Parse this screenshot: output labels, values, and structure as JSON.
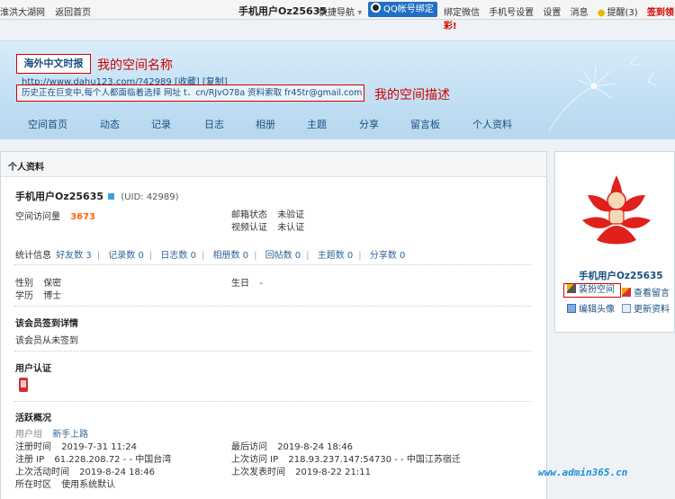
{
  "topbar": {
    "site": "淮洪大湖网",
    "back_home": "返回首页",
    "user": "手机用户Oz25635",
    "quick_nav": "快捷导航",
    "qq_bind": "QQ帐号绑定",
    "links": [
      "绑定微信",
      "手机号设置",
      "设置",
      "消息"
    ],
    "remind": "提醒(3)",
    "signin": "签到领彩!"
  },
  "banner": {
    "space_name": "海外中文时报",
    "space_name_note": "我的空间名称",
    "url_line": "http://www.dahu123.com/?42989 [收藏] [复制]",
    "description": "历史正在巨变中,每个人都面临着选择 网址 t．cn/RJvO78a 资料索取 fr45tr@gmail.com",
    "description_note": "我的空间描述",
    "tabs": [
      "空间首页",
      "动态",
      "记录",
      "日志",
      "相册",
      "主题",
      "分享",
      "留言板",
      "个人资料"
    ]
  },
  "profile": {
    "panel_title": "个人资料",
    "username": "手机用户Oz25635",
    "uid": "(UID: 42989)",
    "visits_label": "空间访问量",
    "visits_value": "3673",
    "email_label": "邮箱状态",
    "email_value": "未验证",
    "video_label": "视频认证",
    "video_value": "未认证",
    "stats_label": "统计信息",
    "stats": [
      "好友数 3",
      "记录数 0",
      "日志数 0",
      "相册数 0",
      "回帖数 0",
      "主题数 0",
      "分享数 0"
    ],
    "gender_label": "性别",
    "gender_value": "保密",
    "birthday_label": "生日",
    "birthday_value": "-",
    "education_label": "学历",
    "education_value": "博士",
    "checkin_title": "该会员签到详情",
    "checkin_text": "该会员从未签到",
    "auth_title": "用户认证",
    "activity_title": "活跃概况",
    "group_label": "用户组",
    "group_value": "新手上路",
    "reg_time_label": "注册时间",
    "reg_time_value": "2019-7-31 11:24",
    "last_visit_label": "最后访问",
    "last_visit_value": "2019-8-24 18:46",
    "reg_ip_label": "注册 IP",
    "reg_ip_value": "61.228.208.72 - - 中国台湾",
    "last_ip_label": "上次访问 IP",
    "last_ip_value": "218.93.237.147:54730 - - 中国江苏宿迁",
    "last_active_label": "上次活动时间",
    "last_active_value": "2019-8-24 18:46",
    "last_post_label": "上次发表时间",
    "last_post_value": "2019-8-22 21:11",
    "zone_label": "所在时区",
    "zone_value": "使用系统默认"
  },
  "sidebar": {
    "name": "手机用户Oz25635",
    "dress_up": "装扮空间",
    "view_messages": "查看留言",
    "edit_avatar": "编辑头像",
    "update_profile": "更新资料"
  },
  "watermark": "www.admin365.cn",
  "colors": {
    "accent_red": "#d40000",
    "link_blue": "#1a4f80",
    "orange": "#ff6600"
  }
}
